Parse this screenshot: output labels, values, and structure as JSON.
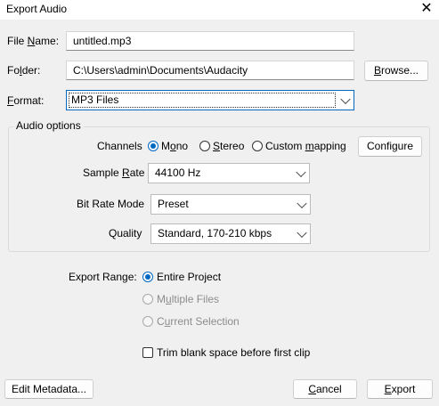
{
  "window": {
    "title": "Export Audio"
  },
  "file_name": {
    "label_pre": "File ",
    "label_key": "N",
    "label_post": "ame:",
    "value": "untitled.mp3"
  },
  "folder": {
    "label_pre": "Fo",
    "label_key": "l",
    "label_post": "der:",
    "value": "C:\\Users\\admin\\Documents\\Audacity",
    "browse_label_pre": "",
    "browse_key": "B",
    "browse_label_post": "rowse..."
  },
  "format": {
    "label_key": "F",
    "label_post": "ormat:",
    "value": "MP3 Files"
  },
  "audio_options": {
    "title": "Audio options",
    "channels": {
      "label": "Channels",
      "mono_pre": "M",
      "mono_key": "o",
      "mono_post": "no",
      "stereo_key": "S",
      "stereo_post": "tereo",
      "custom_pre": "Custom ",
      "custom_key": "m",
      "custom_post": "apping",
      "configure_label": "Configure"
    },
    "sample_rate": {
      "label_pre": "Sample ",
      "label_key": "R",
      "label_post": "ate",
      "value": "44100 Hz"
    },
    "bit_rate_mode": {
      "label": "Bit Rate Mode",
      "value": "Preset"
    },
    "quality": {
      "label": "Quality",
      "value": "Standard, 170-210 kbps"
    }
  },
  "export_range": {
    "label": "Export Range:",
    "entire_project": "Entire Project",
    "multiple_pre": "M",
    "multiple_key": "u",
    "multiple_post": "ltiple Files",
    "current_pre": "C",
    "current_key": "u",
    "current_post": "rrent Selection",
    "trim_label": "Trim blank space before first clip"
  },
  "buttons": {
    "edit_metadata": "Edit Metadata...",
    "cancel_key": "C",
    "cancel_post": "ancel",
    "export_key": "E",
    "export_post": "xport"
  }
}
